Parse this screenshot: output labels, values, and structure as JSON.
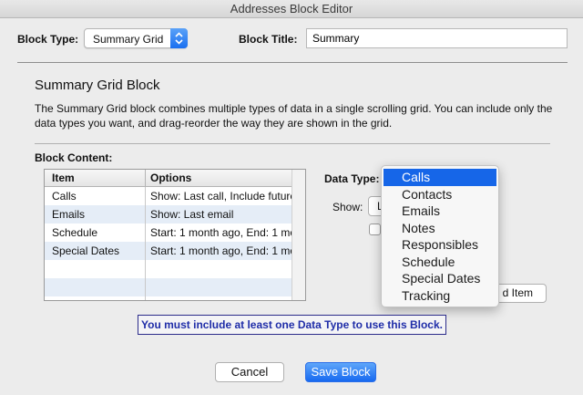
{
  "window": {
    "title": "Addresses Block Editor"
  },
  "header": {
    "block_type_label": "Block Type:",
    "block_type_value": "Summary Grid",
    "block_title_label": "Block Title:",
    "block_title_value": "Summary"
  },
  "section": {
    "heading": "Summary Grid Block",
    "description": "The Summary Grid block combines multiple types of data in a single scrolling grid. You can include only the data types you want, and drag-reorder the way they are shown in the grid."
  },
  "content": {
    "label": "Block Content:",
    "columns": [
      "Item",
      "Options"
    ],
    "rows": [
      {
        "item": "Calls",
        "options": "Show: Last call, Include future"
      },
      {
        "item": "Emails",
        "options": "Show: Last email"
      },
      {
        "item": "Schedule",
        "options": "Start: 1 month ago, End: 1 mo"
      },
      {
        "item": "Special Dates",
        "options": "Start: 1 month ago, End: 1 mo"
      }
    ]
  },
  "side": {
    "data_type_label": "Data Type:",
    "show_label": "Show:",
    "show_value_partial": "L",
    "add_item_partial": "d Item"
  },
  "dropdown": {
    "items": [
      "Calls",
      "Contacts",
      "Emails",
      "Notes",
      "Responsibles",
      "Schedule",
      "Special Dates",
      "Tracking"
    ],
    "selected": "Calls"
  },
  "notice": "You must include at least one Data Type to use this Block.",
  "footer": {
    "cancel": "Cancel",
    "save": "Save Block"
  }
}
